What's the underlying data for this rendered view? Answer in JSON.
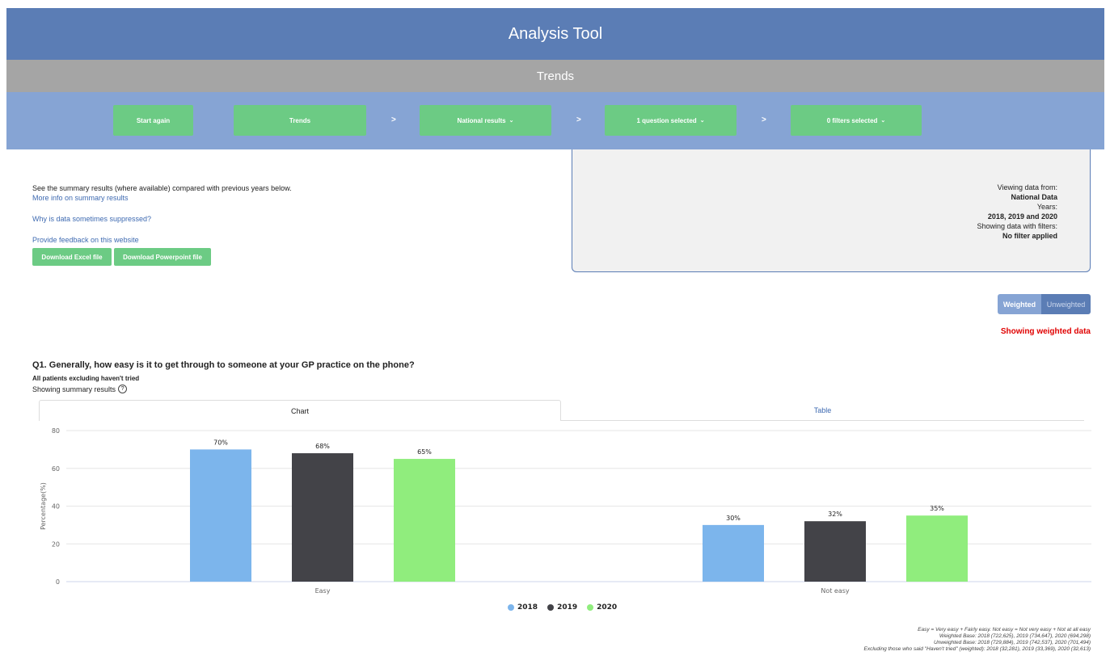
{
  "header": {
    "title": "Analysis Tool",
    "subtitle": "Trends"
  },
  "nav": {
    "start_again": "Start again",
    "trends": "Trends",
    "national": "National results",
    "questions": "1 question selected",
    "filters": "0 filters selected",
    "sep": ">"
  },
  "info": {
    "summary_text": "See the summary results (where available) compared with previous years below.",
    "more_info": "More info on summary results",
    "suppressed": "Why is data sometimes suppressed?",
    "feedback": "Provide feedback on this website",
    "download_excel": "Download Excel file",
    "download_ppt": "Download Powerpoint file"
  },
  "viewing": {
    "label_from": "Viewing data from:",
    "from_value": "National Data",
    "label_years": "Years:",
    "years_value": "2018, 2019 and 2020",
    "label_filters": "Showing data with filters:",
    "filters_value": "No filter applied"
  },
  "toggle": {
    "weighted": "Weighted",
    "unweighted": "Unweighted",
    "status": "Showing weighted data"
  },
  "question": {
    "title": "Q1. Generally, how easy is it to get through to someone at your GP practice on the phone?",
    "base": "All patients excluding haven't tried",
    "summary": "Showing summary results",
    "help": "?"
  },
  "tabs": {
    "chart": "Chart",
    "table": "Table"
  },
  "chart_data": {
    "type": "bar",
    "categories": [
      "Easy",
      "Not easy"
    ],
    "series": [
      {
        "name": "2018",
        "values": [
          70,
          30
        ],
        "color": "#7cb5ec"
      },
      {
        "name": "2019",
        "values": [
          68,
          32
        ],
        "color": "#434348"
      },
      {
        "name": "2020",
        "values": [
          65,
          35
        ],
        "color": "#90ed7d"
      }
    ],
    "ylabel": "Percentage(%)",
    "ylim": [
      0,
      80
    ],
    "yticks": [
      0,
      20,
      40,
      60,
      80
    ],
    "data_labels": [
      [
        "70%",
        "30%"
      ],
      [
        "68%",
        "32%"
      ],
      [
        "65%",
        "35%"
      ]
    ],
    "legend": "bottom-center",
    "grid": true
  },
  "legend_labels": [
    "2018",
    "2019",
    "2020"
  ],
  "footnotes": [
    "Easy = Very easy + Fairly easy. Not easy = Not very easy + Not at all easy",
    "Weighted Base: 2018 (722,625), 2019 (734,647), 2020 (694,298)",
    "Unweighted Base: 2018 (729,884), 2019 (742,537), 2020 (701,494)",
    "Excluding those who said \"Haven't tried\" (weighted): 2018 (32,281), 2019 (33,369), 2020 (32,613)"
  ]
}
